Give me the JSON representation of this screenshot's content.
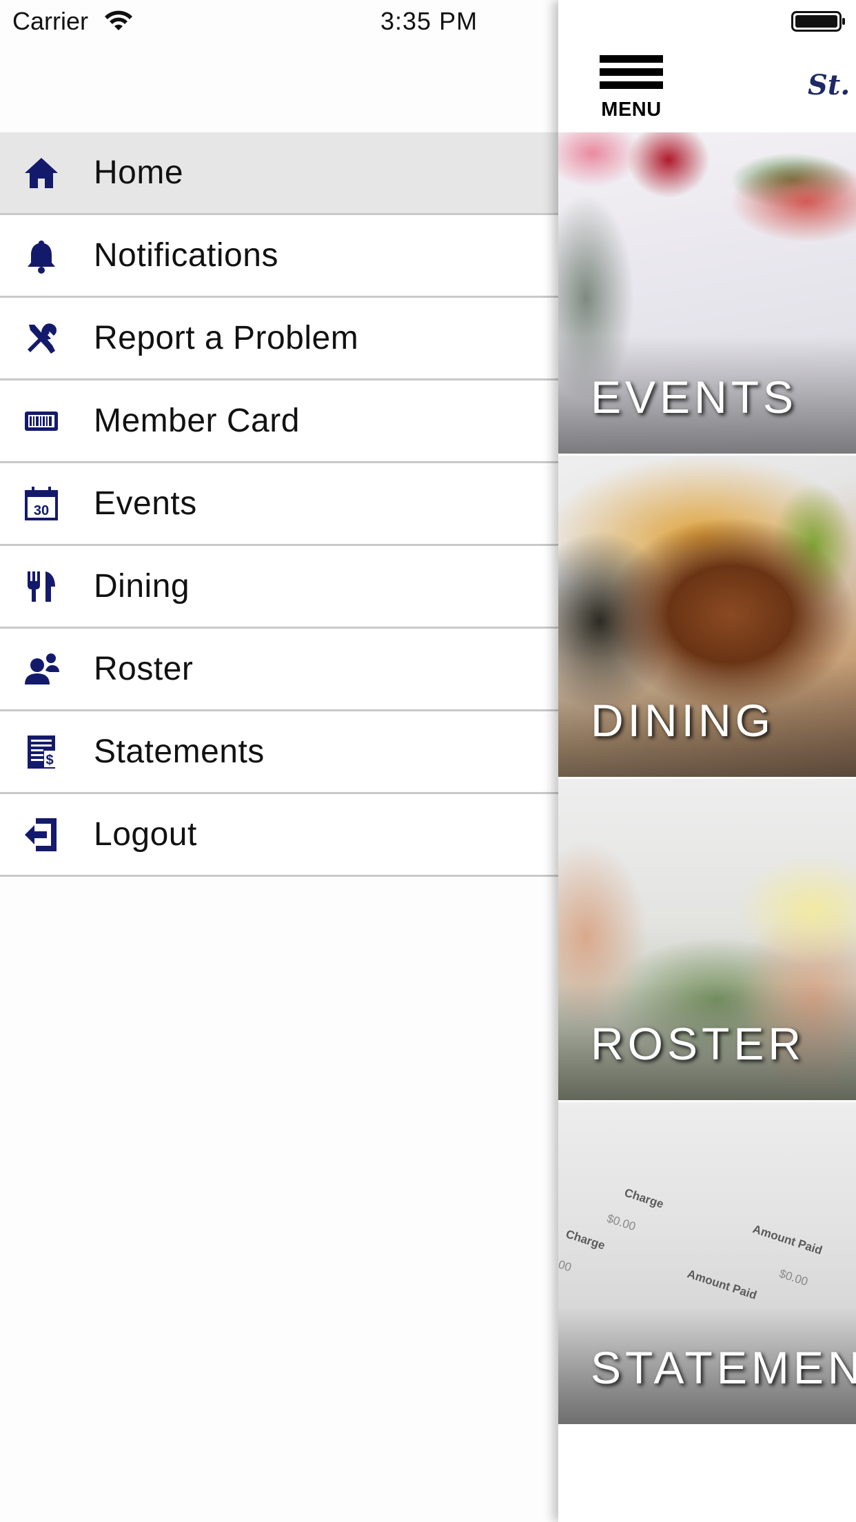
{
  "status_bar": {
    "carrier": "Carrier",
    "time": "3:35 PM"
  },
  "menu": {
    "items": [
      {
        "label": "Home",
        "icon": "home-icon",
        "active": true
      },
      {
        "label": "Notifications",
        "icon": "bell-icon"
      },
      {
        "label": "Report a Problem",
        "icon": "tools-icon"
      },
      {
        "label": "Member Card",
        "icon": "barcode-card-icon"
      },
      {
        "label": "Events",
        "icon": "calendar-icon",
        "calendar_day": "30"
      },
      {
        "label": "Dining",
        "icon": "fork-knife-icon"
      },
      {
        "label": "Roster",
        "icon": "people-icon"
      },
      {
        "label": "Statements",
        "icon": "statement-icon"
      },
      {
        "label": "Logout",
        "icon": "logout-icon"
      }
    ]
  },
  "header": {
    "menu_button_label": "MENU",
    "logo_text": "St."
  },
  "tiles": [
    {
      "label": "EVENTS"
    },
    {
      "label": "DINING"
    },
    {
      "label": "ROSTER"
    },
    {
      "label": "STATEMEN"
    }
  ],
  "statement_image_text": {
    "charge": "Charge",
    "amount_paid": "Amount Paid",
    "zero": "$0.00",
    "partial_zero": "00"
  },
  "colors": {
    "icon_navy": "#141a6b",
    "active_row": "#e6e6e6",
    "divider": "#c9c9c9",
    "logo_navy": "#1d2a66"
  }
}
